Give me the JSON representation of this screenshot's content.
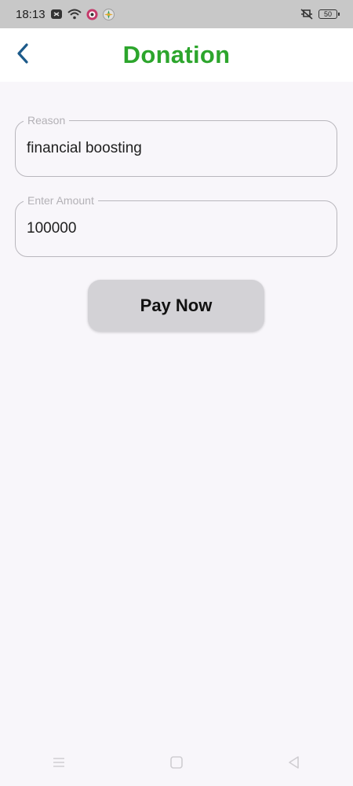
{
  "status_bar": {
    "time": "18:13",
    "battery_level": "50",
    "icons": [
      "notification-icon",
      "wifi-icon",
      "app-notification-icon",
      "app-notification-icon-2",
      "silent-mode-icon",
      "battery-icon"
    ]
  },
  "header": {
    "title": "Donation",
    "back_icon": "chevron-left-icon",
    "title_color": "#2ca52c"
  },
  "form": {
    "reason": {
      "label": "Reason",
      "value": "financial boosting"
    },
    "amount": {
      "label": "Enter Amount",
      "value": "100000"
    },
    "submit_label": "Pay Now"
  },
  "nav_bar": {
    "icons": [
      "menu-icon",
      "home-icon",
      "back-icon"
    ]
  }
}
